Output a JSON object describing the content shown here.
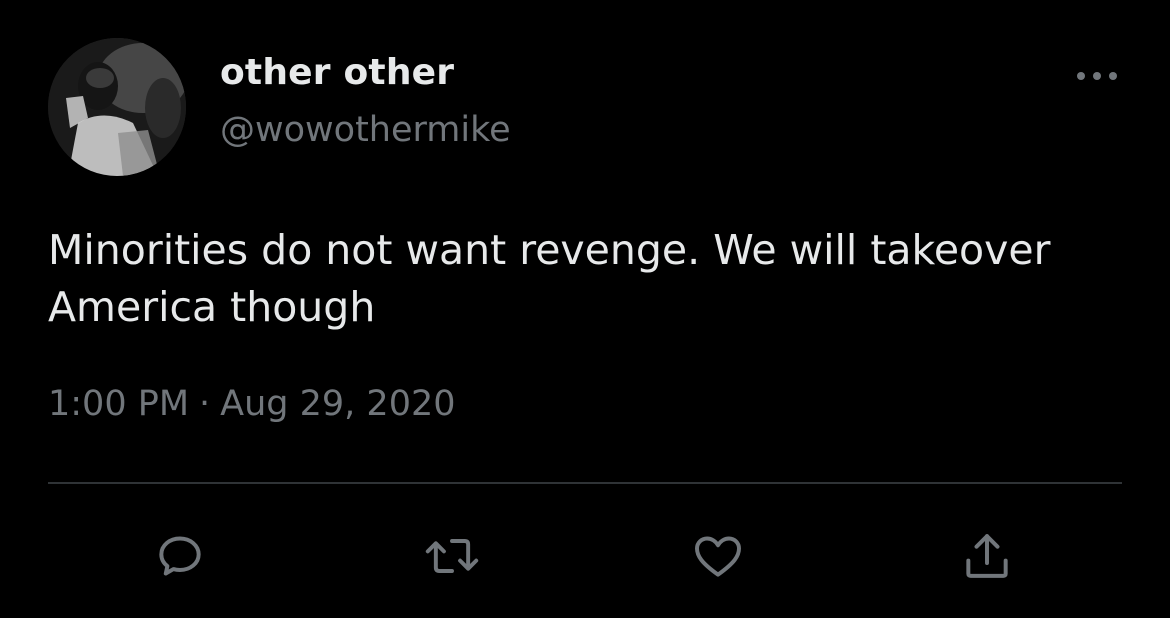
{
  "author": {
    "display_name": "other other",
    "handle": "@wowothermike",
    "avatar_icon": "profile-photo"
  },
  "tweet": {
    "text_line1": "Minorities do not want revenge. We will takeover",
    "text_line2": "America though",
    "time": "1:00 PM",
    "separator": "·",
    "date": "Aug 29, 2020"
  },
  "actions": [
    {
      "name": "reply",
      "icon": "speech-bubble-icon"
    },
    {
      "name": "retweet",
      "icon": "retweet-arrows-icon"
    },
    {
      "name": "like",
      "icon": "heart-icon"
    },
    {
      "name": "share",
      "icon": "share-upload-icon"
    }
  ],
  "colors": {
    "background": "#000000",
    "primary_text": "#e7e9ea",
    "secondary_text": "#71767b",
    "divider": "#2f3336"
  }
}
